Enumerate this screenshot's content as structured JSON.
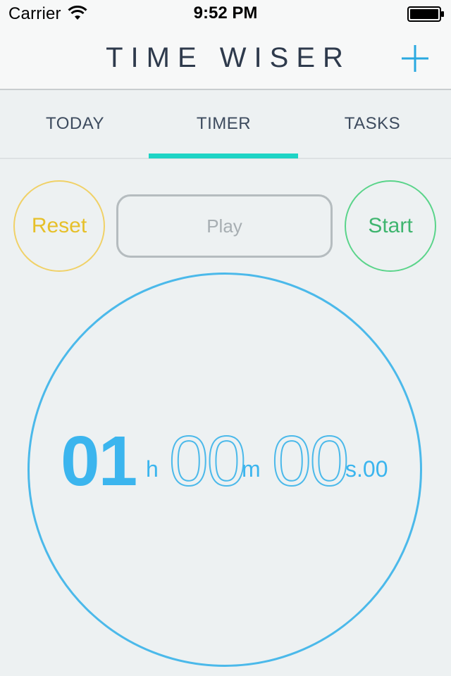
{
  "status_bar": {
    "carrier": "Carrier",
    "time": "9:52 PM"
  },
  "header": {
    "title": "TIME WISER",
    "add_icon": "plus-icon"
  },
  "tabs": [
    {
      "label": "TODAY",
      "selected": false
    },
    {
      "label": "TIMER",
      "selected": true
    },
    {
      "label": "TASKS",
      "selected": false
    }
  ],
  "controls": {
    "reset_label": "Reset",
    "play_label": "Play",
    "start_label": "Start"
  },
  "timer": {
    "hours": "01",
    "hours_unit": "h",
    "minutes": "00",
    "minutes_unit": "m",
    "seconds": "00",
    "seconds_unit": "s.00"
  },
  "colors": {
    "accent": "#1ed4c5",
    "timer_blue": "#3bb5ee",
    "reset_yellow": "#e6c02a",
    "start_green": "#3fb56f",
    "title_navy": "#2e3a4c",
    "background": "#edf1f2"
  }
}
